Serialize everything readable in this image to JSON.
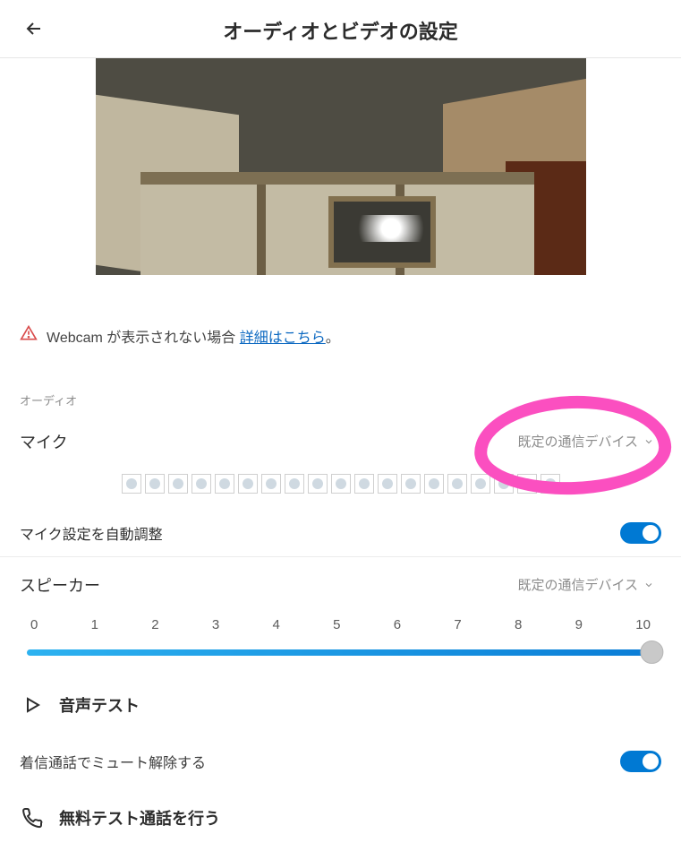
{
  "header": {
    "title": "オーディオとビデオの設定"
  },
  "webcam_warning": {
    "prefix": "Webcam が表示されない場合",
    "link": "詳細はこちら",
    "suffix": "。"
  },
  "audio": {
    "section_label": "オーディオ",
    "microphone": {
      "label": "マイク",
      "selected_device": "既定の通信デバイス",
      "level_cells": 19
    },
    "auto_adjust": {
      "label": "マイク設定を自動調整",
      "enabled": true
    },
    "speaker": {
      "label": "スピーカー",
      "selected_device": "既定の通信デバイス",
      "ticks": [
        "0",
        "1",
        "2",
        "3",
        "4",
        "5",
        "6",
        "7",
        "8",
        "9",
        "10"
      ],
      "value": 10,
      "max": 10
    },
    "sound_test": {
      "label": "音声テスト"
    },
    "unmute_on_incoming": {
      "label": "着信通話でミュート解除する",
      "enabled": true
    },
    "free_test_call": {
      "label": "無料テスト通話を行う"
    }
  }
}
